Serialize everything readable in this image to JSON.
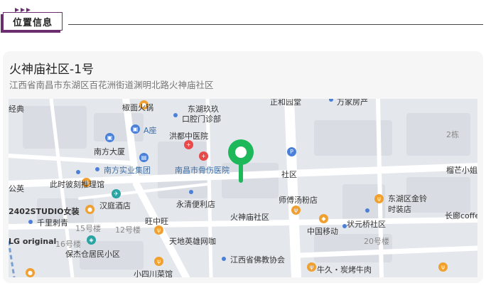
{
  "section": {
    "title": "位置信息"
  },
  "location": {
    "name": "火神庙社区-1号",
    "address": "江西省南昌市东湖区百花洲街道渊明北路火神庙社区"
  },
  "map": {
    "labels": {
      "jingdian": "经典",
      "jiaomian": "椒面火锅",
      "zhengheyuan": "正和园堂",
      "wanjia": "万家房产",
      "donghuruanjiu": "东湖玖玖",
      "koukang": "口腔门诊部",
      "azuo": "A座",
      "hongdu": "洪都中医院",
      "building2": "2栋",
      "nanfangdasha": "南方大厦",
      "nanchanggushang": "南昌市骨伤医院",
      "nanfangshiye": "南方实业集团",
      "shequ": "社区",
      "liuzhi": "榴芒小姐",
      "cishitui": "此时彼刻推理馆",
      "gongyu": "公英",
      "yongqing": "永清便利店",
      "shifu": "师傅汤粉店",
      "donghujinling": "东湖区金铃",
      "shizhuangdian": "时装店",
      "hanting": "汉庭酒店",
      "studio": "2402STUDIO女装",
      "huoshenmiao": "火神庙社区",
      "zhongguoyidong": "中国移动",
      "zhuangyuan": "状元桥社区",
      "changlang": "长廊coffe",
      "qianlijing": "千里刺青",
      "b15": "15号楼",
      "b12": "12号楼",
      "wangzhongwang": "旺中旺",
      "b20": "20号楼",
      "lgoriginal": "LG original",
      "b16": "16号楼",
      "baojian": "保杰仓居民小区",
      "tiandi": "天地英雄网咖",
      "fojiao": "江西省佛教协会",
      "xiaosichuan": "小四川菜馆",
      "niujiu": "牛久・炭烤牛肉"
    }
  },
  "colors": {
    "accent": "#6a2e6e",
    "pin": "#1db85a",
    "road": "#ffffff",
    "block": "#d9dde3",
    "map_bg": "#e4e7ec"
  },
  "icons": {
    "header": "triple-chevron-icon",
    "pin": "map-pin-icon",
    "parking": "parking-icon",
    "food": "fork-knife-icon",
    "hospital": "hospital-cross-icon",
    "hotel": "plane-icon"
  }
}
